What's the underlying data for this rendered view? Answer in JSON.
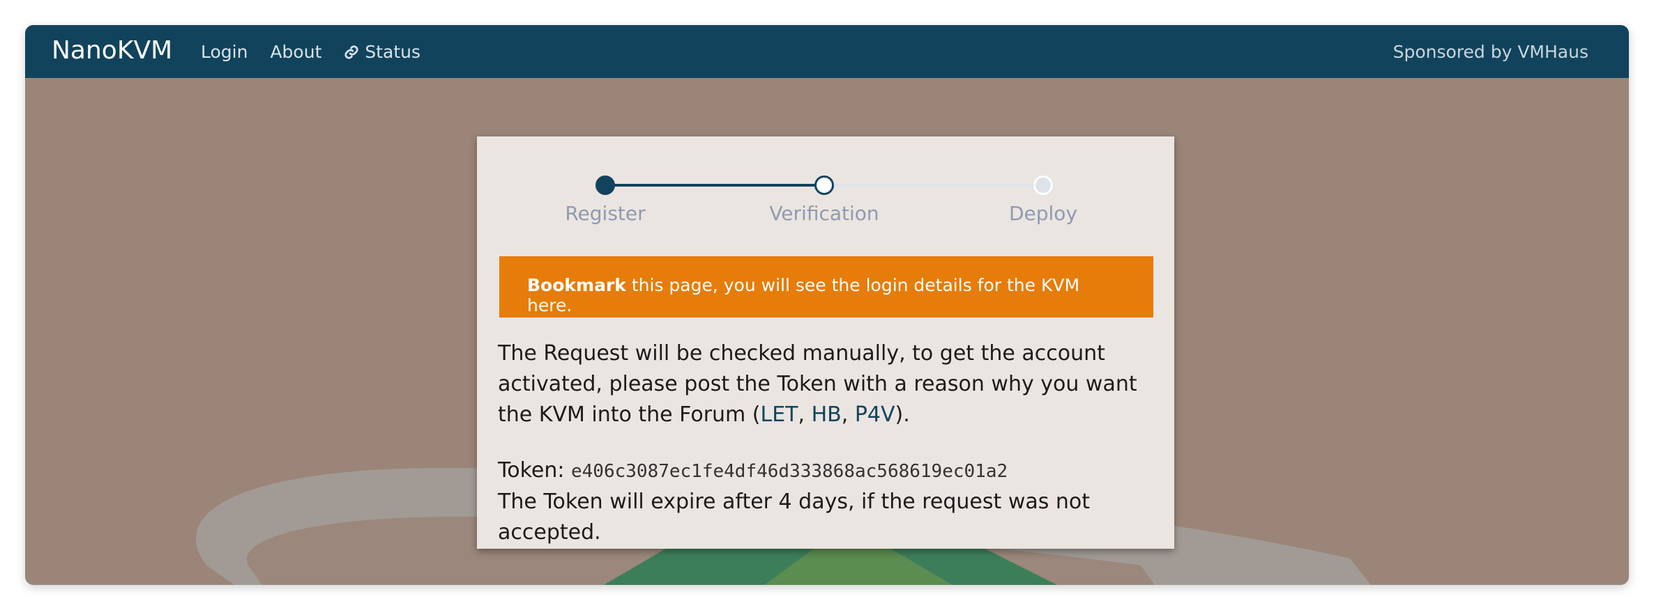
{
  "navbar": {
    "brand": "NanoKVM",
    "links": [
      {
        "label": "Login"
      },
      {
        "label": "About"
      },
      {
        "label": "Status",
        "icon": "link-icon"
      }
    ],
    "sponsor": "Sponsored by VMHaus"
  },
  "stepper": {
    "steps": [
      {
        "label": "Register",
        "state": "done"
      },
      {
        "label": "Verification",
        "state": "current"
      },
      {
        "label": "Deploy",
        "state": "todo"
      }
    ]
  },
  "alert": {
    "bold": "Bookmark",
    "text": " this page, you will see the login details for the KVM here."
  },
  "message": {
    "intro": "The Request will be checked manually, to get the account activated, please post the Token with a reason why you want the KVM into the Forum (",
    "forums": [
      "LET",
      "HB",
      "P4V"
    ],
    "sep": ", ",
    "close": ")."
  },
  "token": {
    "label": "Token: ",
    "value": "e406c3087ec1fe4df46d333868ac568619ec01a2",
    "expiry": "The Token will expire after 4 days, if the request was not accepted."
  },
  "colors": {
    "navbar": "#12435c",
    "alert": "#e67c0a",
    "background": "#9a8578",
    "card": "#ebe5e1"
  }
}
